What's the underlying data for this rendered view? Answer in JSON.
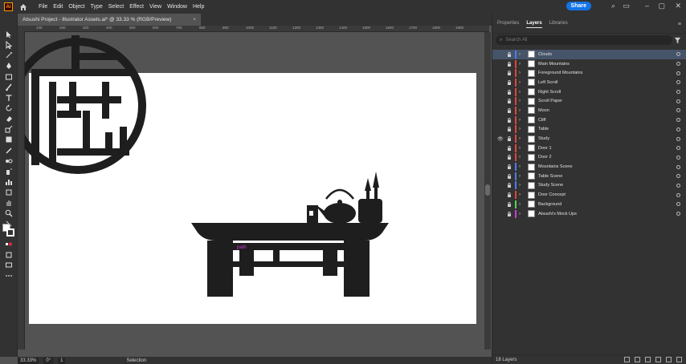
{
  "menubar": {
    "logo": "Ai",
    "items": [
      "File",
      "Edit",
      "Object",
      "Type",
      "Select",
      "Effect",
      "View",
      "Window",
      "Help"
    ],
    "share_label": "Share"
  },
  "document": {
    "tab_title": "Atsushi Project - Illustrator Assets.ai* @ 33.33 % (RGB/Preview)",
    "close_glyph": "×"
  },
  "ruler": {
    "ticks": [
      "",
      "100",
      "200",
      "300",
      "400",
      "500",
      "600",
      "700",
      "800",
      "900",
      "1000",
      "1100",
      "1200",
      "1300",
      "1400",
      "1500",
      "1600",
      "1700",
      "1800",
      "1900"
    ]
  },
  "canvas": {
    "hover_label": "path"
  },
  "status": {
    "zoom": "33.33%",
    "rotation": "0°",
    "artboard": "1",
    "tool": "Selection"
  },
  "panel": {
    "tabs": [
      "Properties",
      "Layers",
      "Libraries"
    ],
    "active_tab": "Layers",
    "search_placeholder": "Search All",
    "footer_count": "18 Layers",
    "layers": [
      {
        "name": "Clouds",
        "color": "#4f7be8",
        "selected": true,
        "visible": false
      },
      {
        "name": "Main Mountains",
        "color": "#e2433f",
        "selected": false,
        "visible": false
      },
      {
        "name": "Foreground Mountains",
        "color": "#e2433f",
        "selected": false,
        "visible": false
      },
      {
        "name": "Left Scroll",
        "color": "#e2433f",
        "selected": false,
        "visible": false
      },
      {
        "name": "Right Scroll",
        "color": "#e2433f",
        "selected": false,
        "visible": false
      },
      {
        "name": "Scroll Paper",
        "color": "#e2433f",
        "selected": false,
        "visible": false
      },
      {
        "name": "Moon",
        "color": "#e2433f",
        "selected": false,
        "visible": false
      },
      {
        "name": "Cliff",
        "color": "#e2433f",
        "selected": false,
        "visible": false
      },
      {
        "name": "Table",
        "color": "#e2433f",
        "selected": false,
        "visible": false
      },
      {
        "name": "Study",
        "color": "#e2433f",
        "selected": false,
        "visible": true
      },
      {
        "name": "Door 1",
        "color": "#e2433f",
        "selected": false,
        "visible": false
      },
      {
        "name": "Door 2",
        "color": "#e2433f",
        "selected": false,
        "visible": false
      },
      {
        "name": "Mountains Scene",
        "color": "#4f7be8",
        "selected": false,
        "visible": false
      },
      {
        "name": "Table Scene",
        "color": "#4f7be8",
        "selected": false,
        "visible": false
      },
      {
        "name": "Study Scene",
        "color": "#4f7be8",
        "selected": false,
        "visible": false
      },
      {
        "name": "Door Concept",
        "color": "#e2433f",
        "selected": false,
        "visible": false
      },
      {
        "name": "Background",
        "color": "#4fd94f",
        "selected": false,
        "visible": false
      },
      {
        "name": "Atsushi's Mock Ups",
        "color": "#c940d6",
        "selected": false,
        "visible": false
      }
    ]
  }
}
